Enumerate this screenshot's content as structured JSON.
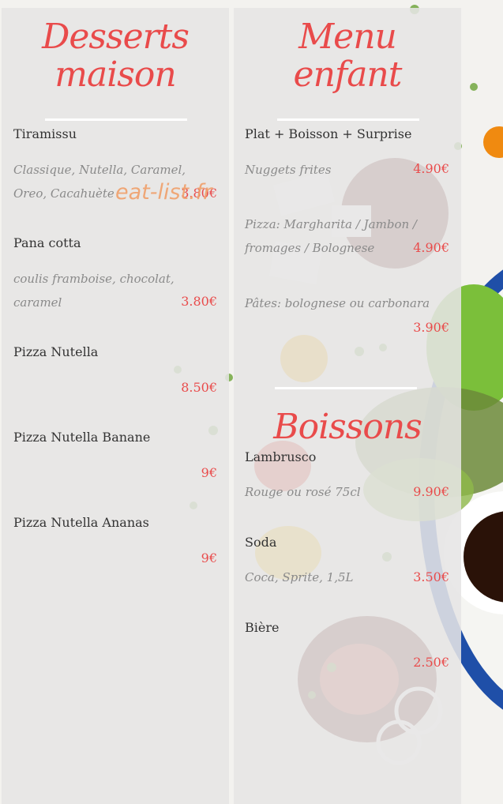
{
  "colors": {
    "accent": "#e94b4b",
    "watermark": "#f0a06a"
  },
  "watermark": "eat-list.fr",
  "desserts": {
    "title_line1": "Desserts",
    "title_line2": "maison",
    "items": [
      {
        "name": "Tiramissu",
        "desc_line1": "Classique, Nutella, Caramel,",
        "desc_line2": "Oreo, Cacahuète",
        "price": "3.80€"
      },
      {
        "name": "Pana cotta",
        "desc_line1": "coulis framboise, chocolat,",
        "desc_line2": "caramel",
        "price": "3.80€"
      },
      {
        "name": "Pizza Nutella",
        "price": "8.50€"
      },
      {
        "name": "Pizza Nutella Banane",
        "price": "9€"
      },
      {
        "name": "Pizza Nutella Ananas",
        "price": "9€"
      }
    ]
  },
  "enfant": {
    "title_line1": "Menu",
    "title_line2": "enfant",
    "heading": "Plat + Boisson + Surprise",
    "items": [
      {
        "desc_line1": "Nuggets frites",
        "price": "4.90€"
      },
      {
        "desc_line1": "Pizza: Margharita / Jambon /",
        "desc_line2": "fromages / Bolognese",
        "price": "4.90€"
      },
      {
        "desc_line1": "Pâtes: bolognese ou carbonara",
        "price": "3.90€"
      }
    ]
  },
  "boissons": {
    "title": "Boissons",
    "items": [
      {
        "name": "Lambrusco",
        "desc": "Rouge ou rosé 75cl",
        "price": "9.90€"
      },
      {
        "name": "Soda",
        "desc": "Coca, Sprite, 1,5L",
        "price": "3.50€"
      },
      {
        "name": "Bière",
        "price": "2.50€"
      }
    ]
  }
}
